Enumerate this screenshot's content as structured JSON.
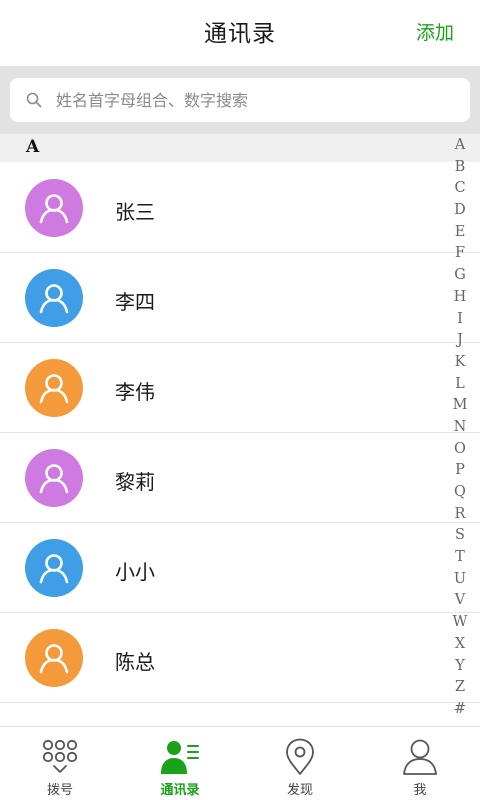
{
  "header": {
    "title": "通讯录",
    "add_label": "添加"
  },
  "search": {
    "placeholder": "姓名首字母组合、数字搜索"
  },
  "section": {
    "letter": "A"
  },
  "contacts": [
    {
      "name": "张三",
      "avatar_color": "#cf7ae0"
    },
    {
      "name": "李四",
      "avatar_color": "#3f9ee6"
    },
    {
      "name": "李伟",
      "avatar_color": "#f59a3b"
    },
    {
      "name": "黎莉",
      "avatar_color": "#cf7ae0"
    },
    {
      "name": "小小",
      "avatar_color": "#3f9ee6"
    },
    {
      "name": "陈总",
      "avatar_color": "#f59a3b"
    }
  ],
  "index_letters": [
    "A",
    "B",
    "C",
    "D",
    "E",
    "F",
    "G",
    "H",
    "I",
    "J",
    "K",
    "L",
    "M",
    "N",
    "O",
    "P",
    "Q",
    "R",
    "S",
    "T",
    "U",
    "V",
    "W",
    "X",
    "Y",
    "Z",
    "#"
  ],
  "tabs": [
    {
      "label": "拨号",
      "icon": "dialpad-icon"
    },
    {
      "label": "通讯录",
      "icon": "contacts-icon"
    },
    {
      "label": "发现",
      "icon": "location-pin-icon"
    },
    {
      "label": "我",
      "icon": "profile-icon"
    }
  ],
  "colors": {
    "accent": "#1aa31a"
  }
}
